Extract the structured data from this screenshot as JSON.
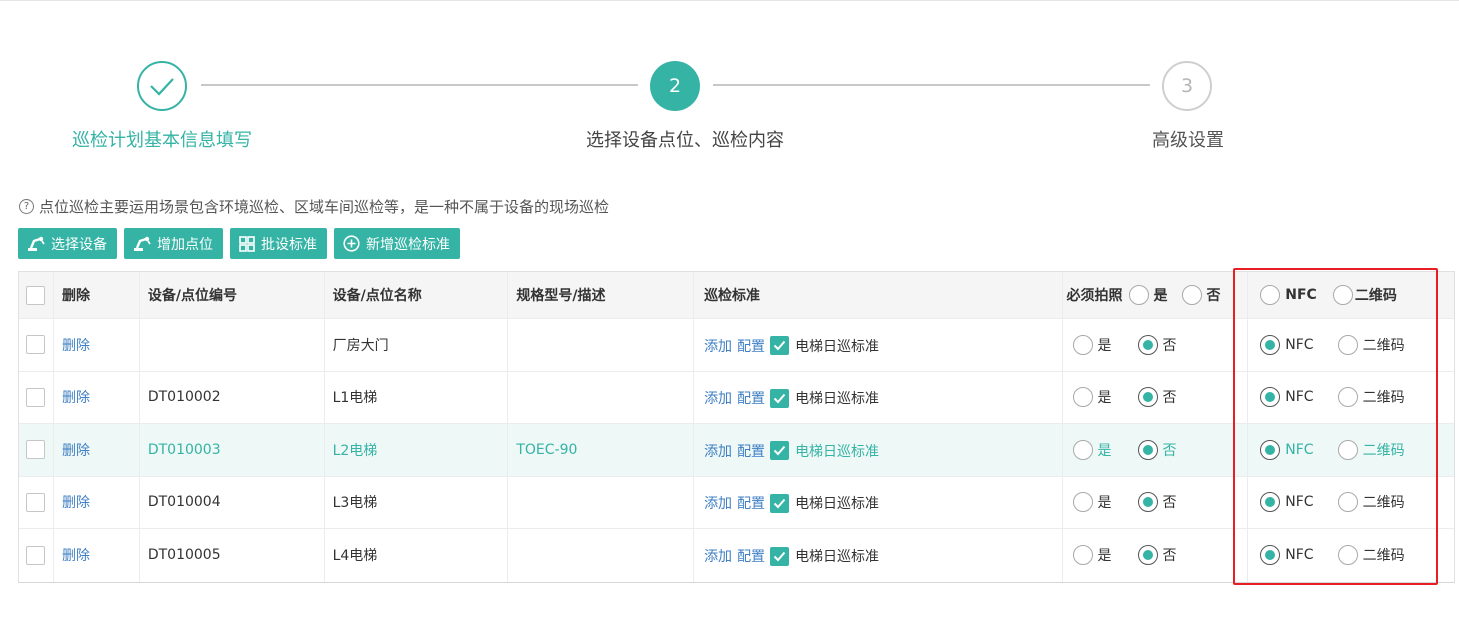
{
  "steps": [
    {
      "number": "",
      "label": "巡检计划基本信息填写",
      "state": "done"
    },
    {
      "number": "2",
      "label": "选择设备点位、巡检内容",
      "state": "active"
    },
    {
      "number": "3",
      "label": "高级设置",
      "state": "todo"
    }
  ],
  "hint": {
    "icon": "question-circle-icon",
    "text": "点位巡检主要运用场景包含环境巡检、区域车间巡检等，是一种不属于设备的现场巡检"
  },
  "toolbar": {
    "select_device": "选择设备",
    "add_point": "增加点位",
    "batch_standard": "批设标准",
    "new_standard": "新增巡检标准"
  },
  "table": {
    "headers": {
      "delete": "删除",
      "code": "设备/点位编号",
      "name": "设备/点位名称",
      "spec": "规格型号/描述",
      "standard": "巡检标准",
      "photo": "必须拍照",
      "yes": "是",
      "no": "否",
      "nfc": "NFC",
      "qr": "二维码"
    },
    "row_actions": {
      "delete": "删除",
      "add": "添加",
      "config": "配置",
      "yes": "是",
      "no": "否",
      "nfc": "NFC",
      "qr": "二维码"
    },
    "rows": [
      {
        "code": "",
        "name": "厂房大门",
        "spec": "",
        "standard": "电梯日巡标准",
        "photo": "否",
        "scan": "NFC"
      },
      {
        "code": "DT010002",
        "name": "L1电梯",
        "spec": "",
        "standard": "电梯日巡标准",
        "photo": "否",
        "scan": "NFC"
      },
      {
        "code": "DT010003",
        "name": "L2电梯",
        "spec": "TOEC-90",
        "standard": "电梯日巡标准",
        "photo": "否",
        "scan": "NFC"
      },
      {
        "code": "DT010004",
        "name": "L3电梯",
        "spec": "",
        "standard": "电梯日巡标准",
        "photo": "否",
        "scan": "NFC"
      },
      {
        "code": "DT010005",
        "name": "L4电梯",
        "spec": "",
        "standard": "电梯日巡标准",
        "photo": "否",
        "scan": "NFC"
      }
    ]
  },
  "colors": {
    "accent": "#35b3a5",
    "link": "#3f7fc4",
    "highlight_box": "#e81e25"
  }
}
